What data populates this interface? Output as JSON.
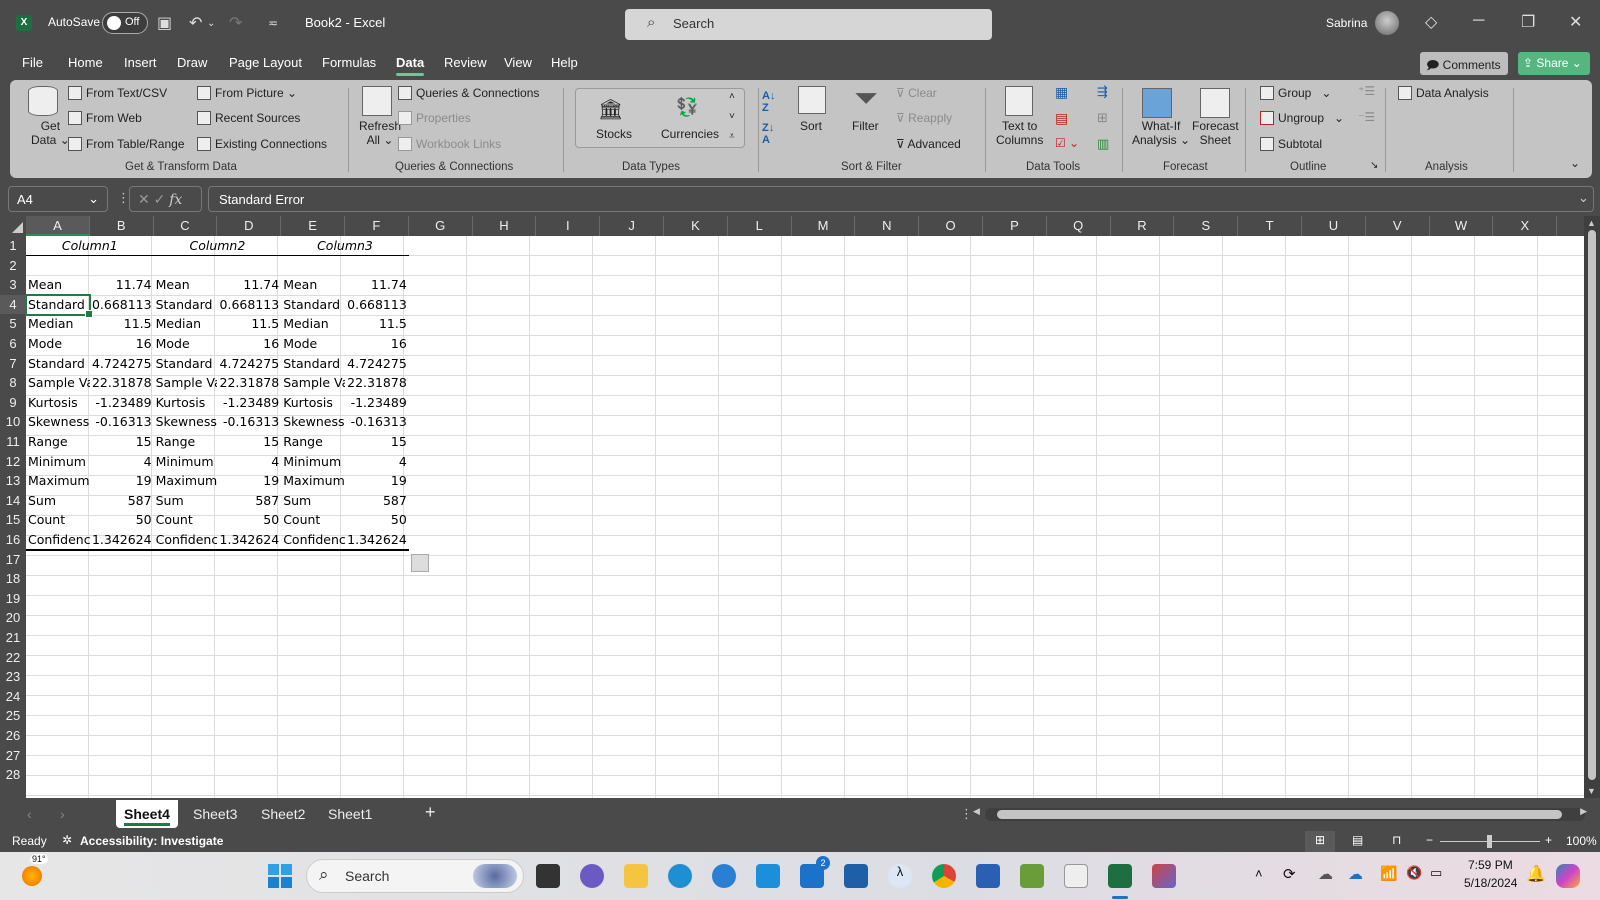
{
  "app": {
    "autosave_label": "AutoSave",
    "autosave_state": "Off",
    "title": "Book2  -  Excel",
    "search_placeholder": "Search",
    "user_name": "Sabrina",
    "icons": [
      "excel-logo-icon",
      "save-icon",
      "undo-icon",
      "redo-icon",
      "customize-quick-access-icon",
      "diamond-premium-icon",
      "minimize-icon",
      "restore-icon",
      "close-icon"
    ]
  },
  "menu": {
    "items": [
      "File",
      "Home",
      "Insert",
      "Draw",
      "Page Layout",
      "Formulas",
      "Data",
      "Review",
      "View",
      "Help"
    ],
    "active": "Data",
    "comments_label": "Comments",
    "share_label": "Share"
  },
  "ribbon": {
    "get_transform": {
      "label": "Get & Transform Data",
      "get_data": [
        "Get",
        "Data"
      ],
      "items": [
        "From Text/CSV",
        "From Web",
        "From Table/Range",
        "From Picture",
        "Recent Sources",
        "Existing Connections"
      ]
    },
    "queries": {
      "label": "Queries & Connections",
      "refresh": [
        "Refresh",
        "All"
      ],
      "items": [
        "Queries & Connections",
        "Properties",
        "Workbook Links"
      ]
    },
    "data_types": {
      "label": "Data Types",
      "items": [
        "Stocks",
        "Currencies"
      ]
    },
    "sort_filter": {
      "label": "Sort & Filter",
      "sort": "Sort",
      "filter": "Filter",
      "items": [
        "Clear",
        "Reapply",
        "Advanced"
      ]
    },
    "data_tools": {
      "label": "Data Tools",
      "text_to_columns": [
        "Text to",
        "Columns"
      ]
    },
    "forecast": {
      "label": "Forecast",
      "what_if": [
        "What-If",
        "Analysis"
      ],
      "forecast_sheet": [
        "Forecast",
        "Sheet"
      ]
    },
    "outline": {
      "label": "Outline",
      "items": [
        "Group",
        "Ungroup",
        "Subtotal"
      ]
    },
    "analysis": {
      "label": "Analysis",
      "items": [
        "Data Analysis"
      ]
    }
  },
  "formula_bar": {
    "name_box": "A4",
    "fx": "fx",
    "content": "Standard Error"
  },
  "sheet": {
    "columns": [
      "A",
      "B",
      "C",
      "D",
      "E",
      "F",
      "G",
      "H",
      "I",
      "J",
      "K",
      "L",
      "M",
      "N",
      "O",
      "P",
      "Q",
      "R",
      "S",
      "T",
      "U",
      "V",
      "W",
      "X"
    ],
    "rows": [
      "1",
      "2",
      "3",
      "4",
      "5",
      "6",
      "7",
      "8",
      "9",
      "10",
      "11",
      "12",
      "13",
      "14",
      "15",
      "16",
      "17",
      "18",
      "19",
      "20",
      "21",
      "22",
      "23",
      "24",
      "25",
      "26",
      "27",
      "28"
    ],
    "selected_cell": "A4",
    "headers": [
      "Column1",
      "Column2",
      "Column3"
    ],
    "stats": [
      {
        "label": "Mean",
        "value": "11.74"
      },
      {
        "label": "Standard",
        "value": "0.668113"
      },
      {
        "label": "Median",
        "value": "11.5"
      },
      {
        "label": "Mode",
        "value": "16"
      },
      {
        "label": "Standard I",
        "value": "4.724275"
      },
      {
        "label": "Sample Va",
        "value": "22.31878"
      },
      {
        "label": "Kurtosis",
        "value": "-1.23489"
      },
      {
        "label": "Skewness",
        "value": "-0.16313"
      },
      {
        "label": "Range",
        "value": "15"
      },
      {
        "label": "Minimum",
        "value": "4"
      },
      {
        "label": "Maximum",
        "value": "19"
      },
      {
        "label": "Sum",
        "value": "587"
      },
      {
        "label": "Count",
        "value": "50"
      },
      {
        "label": "Confidenc",
        "value": "1.342624"
      }
    ],
    "stats_col2_row4_label": "Standard I"
  },
  "sheet_tabs": {
    "tabs": [
      "Sheet4",
      "Sheet3",
      "Sheet2",
      "Sheet1"
    ],
    "active": "Sheet4",
    "add": "+"
  },
  "status": {
    "ready": "Ready",
    "accessibility": "Accessibility: Investigate",
    "zoom": "100%",
    "zoom_minus": "−",
    "zoom_plus": "+"
  },
  "taskbar": {
    "weather": "91°",
    "search": "Search",
    "mail_badge": "2",
    "time": "7:59 PM",
    "date": "5/18/2024",
    "apps": [
      "task-view",
      "teams",
      "file-explorer",
      "edge",
      "get-help",
      "myhp",
      "mail",
      "store",
      "app-lambda",
      "chrome",
      "word",
      "game-app",
      "solitaire",
      "excel",
      "app-art"
    ]
  }
}
